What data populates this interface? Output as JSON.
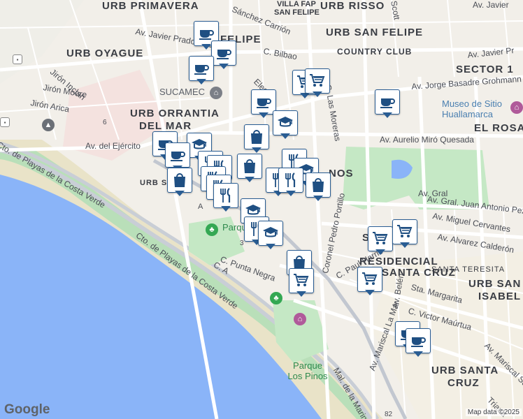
{
  "map": {
    "colors": {
      "land": "#f2efe9",
      "water": "#8ab4f8",
      "park": "#c5e8c5",
      "beach": "#e8e2c4",
      "road": "#ffffff",
      "highway": "#c2c7d0",
      "marker_border": "#2a5d93",
      "marker_icon": "#1f4f82"
    },
    "districts": [
      {
        "name": "URB PRIMAVERA"
      },
      {
        "name": "VILLA FAP"
      },
      {
        "name": "SAN FELIPE"
      },
      {
        "name": "URB RISSO"
      },
      {
        "name": "URB SAN FELIPE"
      },
      {
        "name": "URB OYAGUE"
      },
      {
        "name": "COUNTRY CLUB"
      },
      {
        "name": "SECTOR 1"
      },
      {
        "name": "URB ORRANTIA"
      },
      {
        "name": "DEL MAR"
      },
      {
        "name": "EL ROSAR"
      },
      {
        "name": "URB SAN"
      },
      {
        "name": "SEC"
      },
      {
        "name": "RESIDENCIAL"
      },
      {
        "name": "SANTA CRUZ"
      },
      {
        "name": "SANTA TERESITA"
      },
      {
        "name": "URB SAN"
      },
      {
        "name": "ISABEL"
      },
      {
        "name": "URB SANTA"
      },
      {
        "name": "CRUZ"
      },
      {
        "name": "NOS"
      }
    ],
    "streets": [
      {
        "name": "Sánchez Carrión"
      },
      {
        "name": "Av. Javier Prado Oeste"
      },
      {
        "name": "Av. Javier Pr"
      },
      {
        "name": "Av. Javier"
      },
      {
        "name": "FELIPE"
      },
      {
        "name": "C. Bilbao"
      },
      {
        "name": "Jirón Inclan"
      },
      {
        "name": "Jirón Moore"
      },
      {
        "name": "Jirón Arica"
      },
      {
        "name": "Av. del Ejército"
      },
      {
        "name": "Av. Aurelio Miró Quesada"
      },
      {
        "name": "Av. Jorge Basadre Grohmann"
      },
      {
        "name": "C. Las Moreras"
      },
      {
        "name": "Av. Gral. Juan Antonio Pezet"
      },
      {
        "name": "Av. Miguel Cervantes"
      },
      {
        "name": "Av. Alvarez Calderón"
      },
      {
        "name": "Coronel Pedro Portillo"
      },
      {
        "name": "Cto. de Playas de la Costa Verde"
      },
      {
        "name": "Cto. de Playas de la Costa Verde"
      },
      {
        "name": "C. Punta Negra"
      },
      {
        "name": "C. A"
      },
      {
        "name": "C. Paul Harris"
      },
      {
        "name": "Sta. Margarita"
      },
      {
        "name": "C. Victor Maúrtua"
      },
      {
        "name": "Av. Belén"
      },
      {
        "name": "Av. Mariscal La Mar"
      },
      {
        "name": "Av. Mariscal Sucre"
      },
      {
        "name": "Mal. de la Marina"
      },
      {
        "name": "Elespu"
      },
      {
        "name": "Av. Gral"
      },
      {
        "name": "6"
      },
      {
        "name": "3"
      },
      {
        "name": "A"
      },
      {
        "name": "82"
      },
      {
        "name": "Triana"
      },
      {
        "name": "Scott"
      }
    ],
    "pois": [
      {
        "name": "SUCAMEC"
      },
      {
        "name": "Museo de Sitio Huallamarca"
      },
      {
        "name": "Parque Pera"
      },
      {
        "name": "Parque Los Pinos"
      }
    ],
    "markers": [
      {
        "icon": "cafe"
      },
      {
        "icon": "cafe"
      },
      {
        "icon": "cafe"
      },
      {
        "icon": "cart"
      },
      {
        "icon": "cart"
      },
      {
        "icon": "cafe"
      },
      {
        "icon": "cafe"
      },
      {
        "icon": "school"
      },
      {
        "icon": "shopping-bag"
      },
      {
        "icon": "cafe"
      },
      {
        "icon": "school"
      },
      {
        "icon": "cafe"
      },
      {
        "icon": "shopping-bag"
      },
      {
        "icon": "restaurant"
      },
      {
        "icon": "school"
      },
      {
        "icon": "restaurant"
      },
      {
        "icon": "restaurant"
      },
      {
        "icon": "shopping-bag"
      },
      {
        "icon": "restaurant"
      },
      {
        "icon": "shopping-bag"
      },
      {
        "icon": "restaurant"
      },
      {
        "icon": "restaurant"
      },
      {
        "icon": "restaurant"
      },
      {
        "icon": "restaurant"
      },
      {
        "icon": "school"
      },
      {
        "icon": "restaurant"
      },
      {
        "icon": "school"
      },
      {
        "icon": "shopping-bag"
      },
      {
        "icon": "cart"
      },
      {
        "icon": "cart"
      },
      {
        "icon": "cart"
      },
      {
        "icon": "cart"
      },
      {
        "icon": "cafe"
      },
      {
        "icon": "cafe"
      }
    ],
    "attribution": "Map data ©2025",
    "logo": "Google"
  }
}
